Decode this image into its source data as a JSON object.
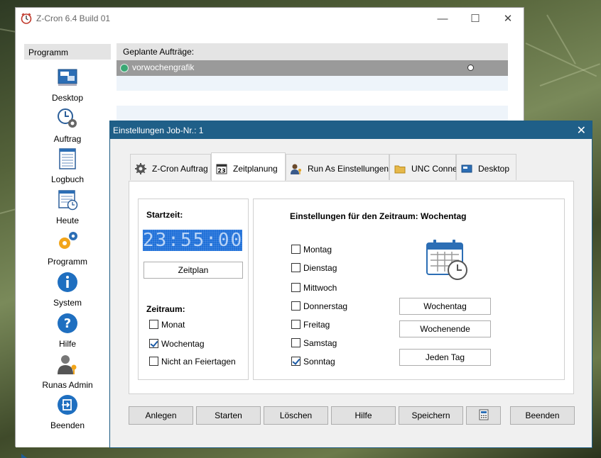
{
  "main_window": {
    "title": "Z-Cron 6.4 Build 01",
    "sidebar": {
      "header": "Programm",
      "items": [
        {
          "label": "Desktop",
          "icon": "desktop-icon"
        },
        {
          "label": "Auftrag",
          "icon": "clock-gear-icon"
        },
        {
          "label": "Logbuch",
          "icon": "logbook-icon"
        },
        {
          "label": "Heute",
          "icon": "calendar-clock-icon"
        },
        {
          "label": "Programm",
          "icon": "gears-icon"
        },
        {
          "label": "System",
          "icon": "info-icon"
        },
        {
          "label": "Hilfe",
          "icon": "help-icon"
        },
        {
          "label": "Runas Admin",
          "icon": "admin-user-icon"
        },
        {
          "label": "Beenden",
          "icon": "exit-icon"
        }
      ]
    },
    "jobs": {
      "header": "Geplante Aufträge:",
      "rows": [
        {
          "name": "vorwochengrafik"
        }
      ]
    }
  },
  "dialog": {
    "title": "Einstellungen Job-Nr.: 1",
    "tabs": [
      {
        "label": "Z-Cron Auftrag",
        "icon": "gear-icon"
      },
      {
        "label": "Zeitplanung",
        "icon": "calendar-23-icon",
        "active": true
      },
      {
        "label": "Run As Einstellungen",
        "icon": "user-key-icon"
      },
      {
        "label": "UNC Connect",
        "icon": "folder-icon"
      },
      {
        "label": "Desktop",
        "icon": "monitor-icon"
      }
    ],
    "startzeit": {
      "label": "Startzeit:",
      "time": "23:55:00",
      "zeitplan_button": "Zeitplan"
    },
    "zeitraum": {
      "label": "Zeitraum:",
      "options": [
        {
          "label": "Monat",
          "checked": false
        },
        {
          "label": "Wochentag",
          "checked": true
        },
        {
          "label": "Nicht an Feiertagen",
          "checked": false
        }
      ]
    },
    "period_settings": {
      "title": "Einstellungen für den Zeitraum: Wochentag",
      "days": [
        {
          "label": "Montag",
          "checked": false
        },
        {
          "label": "Dienstag",
          "checked": false
        },
        {
          "label": "Mittwoch",
          "checked": false
        },
        {
          "label": "Donnerstag",
          "checked": false
        },
        {
          "label": "Freitag",
          "checked": false
        },
        {
          "label": "Samstag",
          "checked": false
        },
        {
          "label": "Sonntag",
          "checked": true
        }
      ],
      "buttons": {
        "wochentag": "Wochentag",
        "wochenende": "Wochenende",
        "jeden_tag": "Jeden Tag"
      }
    },
    "bottom_buttons": {
      "anlegen": "Anlegen",
      "starten": "Starten",
      "loeschen": "Löschen",
      "hilfe": "Hilfe",
      "speichern": "Speichern",
      "beenden": "Beenden"
    },
    "colors": {
      "titlebar": "#1f5f88",
      "lcd": "#1e6fd8",
      "accent": "#1a5aa6"
    }
  }
}
